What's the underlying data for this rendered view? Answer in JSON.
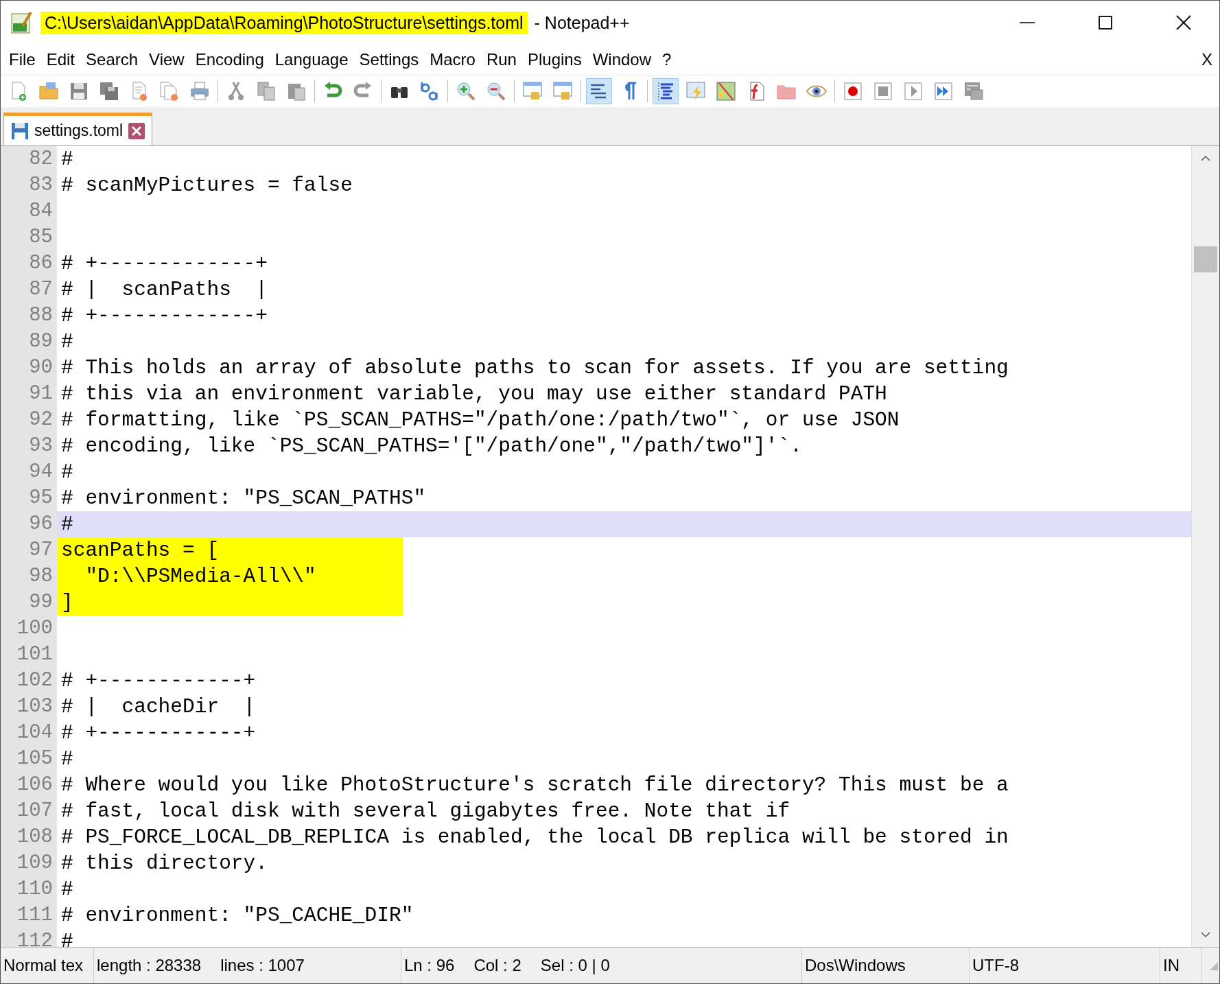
{
  "window": {
    "title_path": "C:\\Users\\aidan\\AppData\\Roaming\\PhotoStructure\\settings.toml",
    "title_app": "- Notepad++"
  },
  "menu": {
    "items": [
      "File",
      "Edit",
      "Search",
      "View",
      "Encoding",
      "Language",
      "Settings",
      "Macro",
      "Run",
      "Plugins",
      "Window",
      "?"
    ],
    "close_label": "X"
  },
  "tabs": [
    {
      "label": "settings.toml",
      "selected": true
    }
  ],
  "editor": {
    "lines": [
      {
        "number": "82",
        "text": "#",
        "current": false,
        "marked": false
      },
      {
        "number": "83",
        "text": "# scanMyPictures = false",
        "current": false,
        "marked": false
      },
      {
        "number": "84",
        "current": false,
        "marked": false
      },
      {
        "number": "85",
        "current": false,
        "marked": false
      },
      {
        "number": "86",
        "text": "# +-------------+",
        "current": false,
        "marked": false
      },
      {
        "number": "87",
        "text": "# |  scanPaths  |",
        "current": false,
        "marked": false
      },
      {
        "number": "88",
        "text": "# +-------------+",
        "current": false,
        "marked": false
      },
      {
        "number": "89",
        "text": "#",
        "current": false,
        "marked": false
      },
      {
        "number": "90",
        "text": "# This holds an array of absolute paths to scan for assets. If you are setting",
        "current": false,
        "marked": false
      },
      {
        "number": "91",
        "text": "# this via an environment variable, you may use either standard PATH",
        "current": false,
        "marked": false
      },
      {
        "number": "92",
        "text": "# formatting, like `PS_SCAN_PATHS=\"/path/one:/path/two\"`, or use JSON",
        "current": false,
        "marked": false
      },
      {
        "number": "93",
        "text": "# encoding, like `PS_SCAN_PATHS='[\"/path/one\",\"/path/two\"]'`.",
        "current": false,
        "marked": false
      },
      {
        "number": "94",
        "text": "#",
        "current": false,
        "marked": false
      },
      {
        "number": "95",
        "text": "# environment: \"PS_SCAN_PATHS\"",
        "current": false,
        "marked": false
      },
      {
        "number": "96",
        "text": "#",
        "current": true,
        "marked": false
      },
      {
        "number": "97",
        "text": "scanPaths = [",
        "current": false,
        "marked": true
      },
      {
        "number": "98",
        "text": "  \"D:\\\\PSMedia-All\\\\\"",
        "current": false,
        "marked": true
      },
      {
        "number": "99",
        "text": "]",
        "current": false,
        "marked": true
      },
      {
        "number": "100",
        "current": false,
        "marked": false
      },
      {
        "number": "101",
        "current": false,
        "marked": false
      },
      {
        "number": "102",
        "text": "# +------------+",
        "current": false,
        "marked": false
      },
      {
        "number": "103",
        "text": "# |  cacheDir  |",
        "current": false,
        "marked": false
      },
      {
        "number": "104",
        "text": "# +------------+",
        "current": false,
        "marked": false
      },
      {
        "number": "105",
        "text": "#",
        "current": false,
        "marked": false
      },
      {
        "number": "106",
        "text": "# Where would you like PhotoStructure's scratch file directory? This must be a",
        "current": false,
        "marked": false
      },
      {
        "number": "107",
        "text": "# fast, local disk with several gigabytes free. Note that if",
        "current": false,
        "marked": false
      },
      {
        "number": "108",
        "text": "# PS_FORCE_LOCAL_DB_REPLICA is enabled, the local DB replica will be stored in",
        "current": false,
        "marked": false
      },
      {
        "number": "109",
        "text": "# this directory.",
        "current": false,
        "marked": false
      },
      {
        "number": "110",
        "text": "#",
        "current": false,
        "marked": false
      },
      {
        "number": "111",
        "text": "# environment: \"PS_CACHE_DIR\"",
        "current": false,
        "marked": false
      },
      {
        "number": "112",
        "text": "#",
        "current": false,
        "marked": false
      }
    ]
  },
  "status_bar": {
    "file_type": "Normal tex",
    "length": "length : 28338",
    "lines": "lines : 1007",
    "line": "Ln : 96",
    "column": "Col : 2",
    "selection": "Sel : 0 | 0",
    "eol": "Dos\\Windows",
    "encoding": "UTF-8",
    "mode": "IN"
  }
}
